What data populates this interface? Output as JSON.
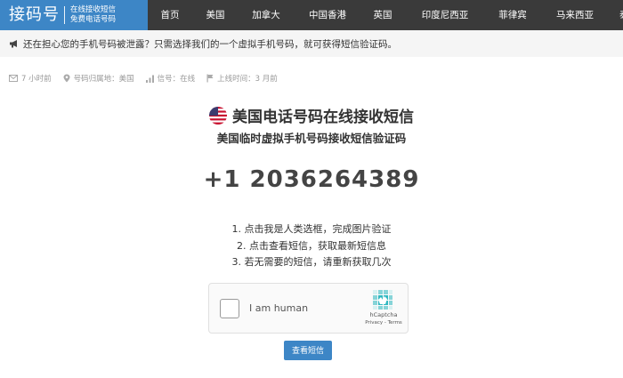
{
  "logo": {
    "main": "接码号",
    "sub_line1": "在线接收短信",
    "sub_line2": "免费电话号码"
  },
  "nav": [
    "首页",
    "美国",
    "加拿大",
    "中国香港",
    "英国",
    "印度尼西亚",
    "菲律宾",
    "马来西亚",
    "泰国"
  ],
  "notice": {
    "icon": "megaphone-icon",
    "text": "还在担心您的手机号码被泄露？只需选择我们的一个虚拟手机号码，就可获得短信验证码。"
  },
  "meta": {
    "time": "7 小时前",
    "location": "号码归属地：美国",
    "signal": "信号：在线",
    "online": "上线时间：3 月前"
  },
  "title": "美国电话号码在线接收短信",
  "subtitle": "美国临时虚拟手机号码接收短信验证码",
  "phone": "+1 2036264389",
  "steps": [
    "1. 点击我是人类选框，完成图片验证",
    "2. 点击查看短信，获取最新短信息",
    "3. 若无需要的短信，请重新获取几次"
  ],
  "captcha": {
    "label": "I am human",
    "brand": "hCaptcha",
    "privacy": "Privacy",
    "sep": " - ",
    "terms": "Terms"
  },
  "button": "查看短信",
  "colors": {
    "nav_bg": "#3a3a3a",
    "accent": "#3d86c6",
    "notice_bg": "#f5f5f5"
  }
}
